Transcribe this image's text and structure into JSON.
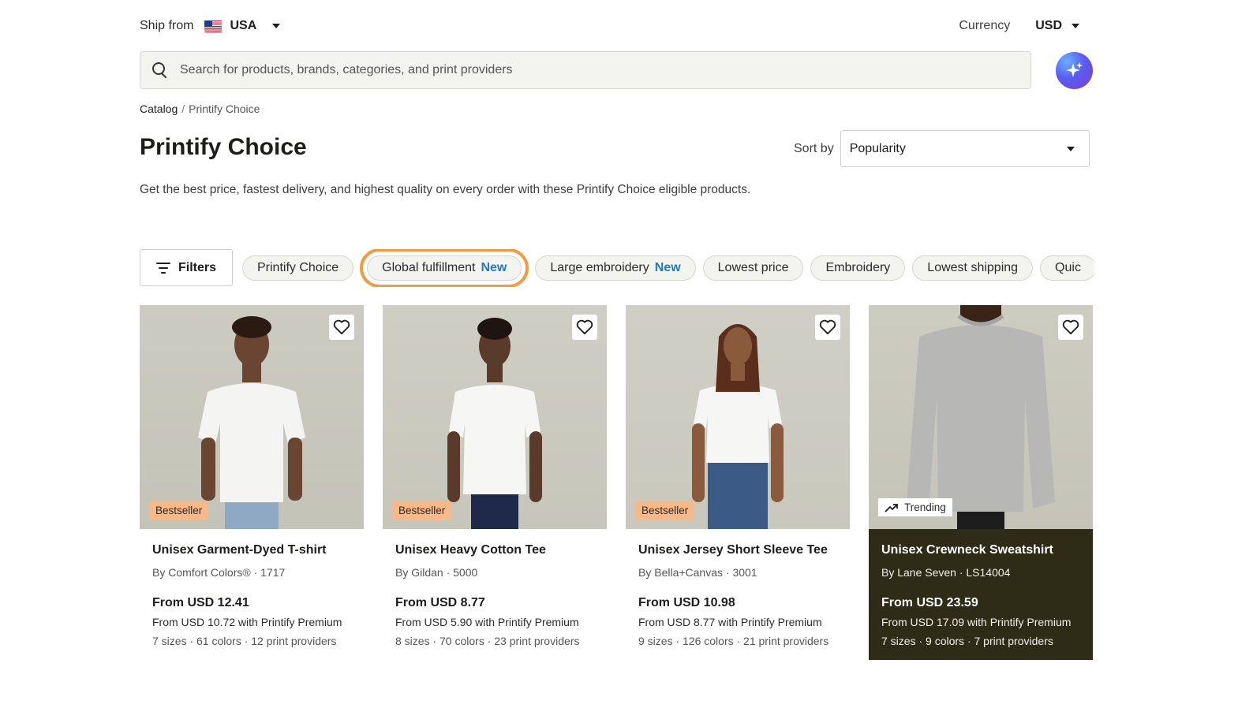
{
  "topbar": {
    "ship_from_label": "Ship from",
    "ship_country": "USA",
    "currency_label": "Currency",
    "currency_value": "USD"
  },
  "search": {
    "placeholder": "Search for products, brands, categories, and print providers"
  },
  "breadcrumb": {
    "items": [
      "Catalog",
      "Printify Choice"
    ],
    "separator": "/"
  },
  "page": {
    "title": "Printify Choice",
    "subtitle": "Get the best price, fastest delivery, and highest quality on every order with these Printify Choice eligible products."
  },
  "sort": {
    "label": "Sort by",
    "value": "Popularity"
  },
  "filters": {
    "button_label": "Filters",
    "chips": [
      {
        "label": "Printify Choice",
        "new": ""
      },
      {
        "label": "Global fulfillment",
        "new": "New"
      },
      {
        "label": "Large embroidery",
        "new": "New"
      },
      {
        "label": "Lowest price",
        "new": ""
      },
      {
        "label": "Embroidery",
        "new": ""
      },
      {
        "label": "Lowest shipping",
        "new": ""
      },
      {
        "label": "Quic",
        "new": ""
      }
    ]
  },
  "colors": {
    "accent_highlight": "#f59a3e",
    "new_badge": "#1f7bc1",
    "bestseller_badge": "#f7b98a",
    "dark_card": "#2e2b16"
  },
  "products": [
    {
      "name": "Unisex Garment-Dyed T-shirt",
      "brand": "By Comfort Colors® · 1717",
      "price": "From USD 12.41",
      "premium": "From USD 10.72 with Printify Premium",
      "meta": "7 sizes · 61 colors · 12 print providers",
      "badge": "Bestseller"
    },
    {
      "name": "Unisex Heavy Cotton Tee",
      "brand": "By Gildan · 5000",
      "price": "From USD 8.77",
      "premium": "From USD 5.90 with Printify Premium",
      "meta": "8 sizes · 70 colors · 23 print providers",
      "badge": "Bestseller"
    },
    {
      "name": "Unisex Jersey Short Sleeve Tee",
      "brand": "By Bella+Canvas · 3001",
      "price": "From USD 10.98",
      "premium": "From USD 8.77 with Printify Premium",
      "meta": "9 sizes · 126 colors · 21 print providers",
      "badge": "Bestseller"
    },
    {
      "name": "Unisex Crewneck Sweatshirt",
      "brand": "By Lane Seven · LS14004",
      "price": "From USD 23.59",
      "premium": "From USD 17.09 with Printify Premium",
      "meta": "7 sizes · 9 colors · 7 print providers",
      "badge": "Trending"
    }
  ]
}
